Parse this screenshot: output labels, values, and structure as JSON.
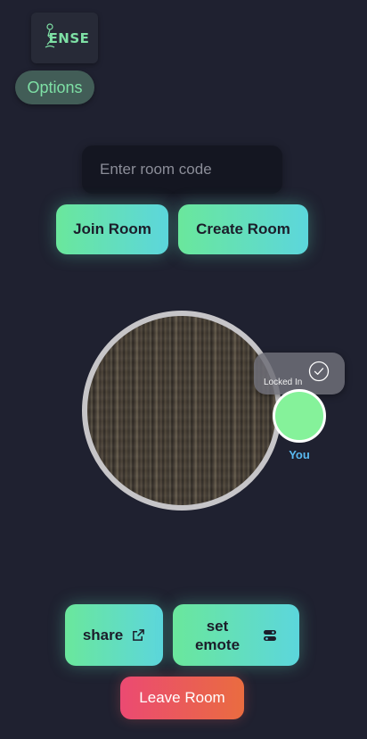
{
  "logo": {
    "text": "ENSE",
    "icon": "person-figure-icon"
  },
  "options": {
    "label": "Options"
  },
  "room": {
    "placeholder": "Enter room code",
    "join_label": "Join Room",
    "create_label": "Create Room"
  },
  "status": {
    "locked_label": "Locked In",
    "icon": "check-circle-icon"
  },
  "player": {
    "label": "You",
    "color": "#85f29a"
  },
  "actions": {
    "share_label": "share",
    "share_icon": "external-link-icon",
    "emote_label_line1": "set",
    "emote_label_line2": "emote",
    "emote_icon": "toggle-icon",
    "leave_label": "Leave Room"
  },
  "colors": {
    "background": "#1f2130",
    "accent_green": "#6ae79c",
    "accent_cyan": "#5cd6dc",
    "danger": "#eb4a72"
  }
}
